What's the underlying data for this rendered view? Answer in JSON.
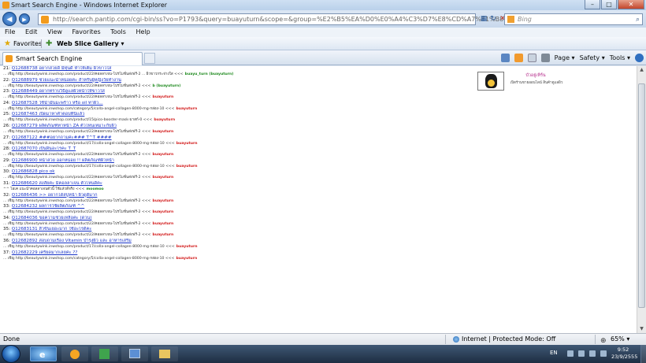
{
  "window": {
    "title": "Smart Search Engine - Windows Internet Explorer",
    "buttons": [
      "–",
      "□",
      "✕"
    ]
  },
  "address": {
    "url": "http://search.pantip.com/cgi-bin/ss?vo=P1793&query=buayuturn&scope=&group=%E2%B5%EA%D0%E0%A4%C3%D7%E8%CD%A7%E1%B8%E9%A7&page=2"
  },
  "search": {
    "placeholder": "Bing"
  },
  "menu": [
    "File",
    "Edit",
    "View",
    "Favorites",
    "Tools",
    "Help"
  ],
  "favorites_bar": {
    "favorites_label": "Favorites",
    "web_slice_label": "Web Slice Gallery ▾"
  },
  "tab": {
    "title": "Smart Search Engine"
  },
  "commands": {
    "page": "Page ▾",
    "safety": "Safety ▾",
    "tools": "Tools ▾"
  },
  "results": [
    {
      "num": "21:",
      "link": "Q12688738 อยากสวยดี มีหุ่นดี หำให้เต็ม ผิวขาวใส",
      "snippet": "... เชิญ http://beautywink.inwshop.com/product/22/คอลลาเจน-โปรโมชั่นส่งฟรี-2 ... ผิวขาวกระจ่างใส",
      "user": "buayu_turn (buayuturn)",
      "user_color": "green"
    },
    {
      "num": "22:",
      "link": "Q12688979 ช่วยแนะนำหน่อยค่ะ สำหรับผู้หญิงวัยทำงาน",
      "snippet": "... เชิญ http://beautywink.inwshop.com/product/22/คอลลาเจน-โปรโมชั่นส่งฟรี-2",
      "user": "b (buayuturn)",
      "user_color": "green"
    },
    {
      "num": "23:",
      "link": "Q12688449 อยากทราบวิธีดูแลผิวหน้าให้ขาวใส",
      "snippet": "... เชิญ http://beautywink.inwshop.com/product/22/คอลลาเจน-โปรโมชั่นส่งฟรี-2",
      "user": "buayuturn",
      "user_color": "red"
    },
    {
      "num": "24:",
      "link": "Q12687528 ใช้น้ำมันมะพร้าว หรือ oil ทาผิว...",
      "snippet": "... เชิญ http://beautywink.inwshop.com/category/5/colla-angel-collagen-8000-mg-กล่อง-10",
      "user": "buayuturn",
      "user_color": "red"
    },
    {
      "num": "25:",
      "link": "Q12687463 เปิดมาหาคำตอบที่นี่แล้ว",
      "snippet": "... เชิญ http://beautywink.inwshop.com/product/15/pico-booster-mask-มาสก์-0",
      "user": "buayuturn",
      "user_color": "red"
    },
    {
      "num": "26:",
      "link": "Q12687279 ผลิตภัณฑ์ทาหน้า ZA ตัวไหนเหมาะกับผิว",
      "snippet": "... เชิญ http://beautywink.inwshop.com/product/22/คอลลาเจน-โปรโมชั่นส่งฟรี-2",
      "user": "buayuturn",
      "user_color": "red"
    },
    {
      "num": "27:",
      "link": "Q12687122 ###อยากถามค่ะ### T^T ####",
      "snippet": "... เชิญ http://beautywink.inwshop.com/product/17/colla-angel-collagen-8000-mg-กล่อง-10",
      "user": "buayuturn",
      "user_color": "red"
    },
    {
      "num": "28:",
      "link": "Q12687070 เป็นผื่นอะไรคะ T_T",
      "snippet": "... เชิญ http://beautywink.inwshop.com/product/22/คอลลาเจน-โปรโมชั่นส่งฟรี-2",
      "user": "buayuturn",
      "user_color": "red"
    },
    {
      "num": "29:",
      "link": "Q12686900 หน้าสวย ออกหน่อย !! ผลิตภัณฑ์ผิวหน้า",
      "snippet": "... เชิญ http://beautywink.inwshop.com/product/17/colla-angel-collagen-8000-mg-กล่อง-10",
      "user": "buayuturn",
      "user_color": "red"
    },
    {
      "num": "30:",
      "link": "Q12686828 pico ok",
      "snippet": "... เชิญ http://beautywink.inwshop.com/product/22/คอลลาเจน-โปรโมชั่นส่งฟรี-2",
      "user": "buayuturn",
      "user_color": "red"
    },
    {
      "num": "31:",
      "link": "Q12686620 สงสัยค่ะ มีคอลลาเจน ตัวไหนดีคะ",
      "snippet": "^^ โอเค แนะนำคอลลาเจนตัวนี้ ใช้แล้วดีจริง",
      "user": "moomoo",
      "user_color": "green"
    },
    {
      "num": "32:",
      "link": "Q12686436 >> อยากได้สบู่หน้า ผิวดูดีมาก",
      "snippet": "... เชิญ http://beautywink.inwshop.com/product/22/คอลลาเจน-โปรโมชั่นส่งฟรี-2",
      "user": "buayuturn",
      "user_color": "red"
    },
    {
      "num": "33:",
      "link": "Q12684232 ผลการใช้ผลิตภัณฑ์ ^^",
      "snippet": "... เชิญ http://beautywink.inwshop.com/product/22/คอลลาเจน-โปรโมชั่นส่งฟรี-2",
      "user": "buayuturn",
      "user_color": "red"
    },
    {
      "num": "34:",
      "link": "Q12684036 ขอความช่วยเหลือค่ะ (ด่วน)",
      "snippet": "... เชิญ http://beautywink.inwshop.com/product/22/คอลลาเจน-โปรโมชั่นส่งฟรี-2",
      "user": "buayuturn",
      "user_color": "red"
    },
    {
      "num": "35:",
      "link": "Q12683131 สิวขึ้นเยอะมาก ใช้อะไรดีคะ",
      "snippet": "... เชิญ http://beautywink.inwshop.com/product/22/คอลลาเจน-โปรโมชั่นส่งฟรี-2",
      "user": "buayuturn",
      "user_color": "red"
    },
    {
      "num": "36:",
      "link": "Q12682892 สอบถามเรื่อง Vitamin บำรุงผิว และ อาหารเสริม",
      "snippet": "... เชิญ http://beautywink.inwshop.com/product/17/colla-angel-collagen-8000-mg-กล่อง-10",
      "user": "buayuturn",
      "user_color": "red"
    },
    {
      "num": "37:",
      "link": "Q12682229 เครียดมากเลยค่ะ ??",
      "snippet": "... เชิญ http://beautywink.inwshop.com/category/5/colla-angel-collagen-8000-mg-กล่อง-10",
      "user": "buayuturn",
      "user_color": "red"
    }
  ],
  "result_arrow": "<<<",
  "profile": {
    "name": "บัวอยู่เทิร์น",
    "desc": "เปิดร้านขายออนไลน์ สินค้าดูแลผิว"
  },
  "status": {
    "done": "Done",
    "zone": "Internet | Protected Mode: Off",
    "zoom": "65% ▾"
  },
  "tray": {
    "lang": "EN",
    "time": "9:52",
    "date": "23/9/2555"
  }
}
